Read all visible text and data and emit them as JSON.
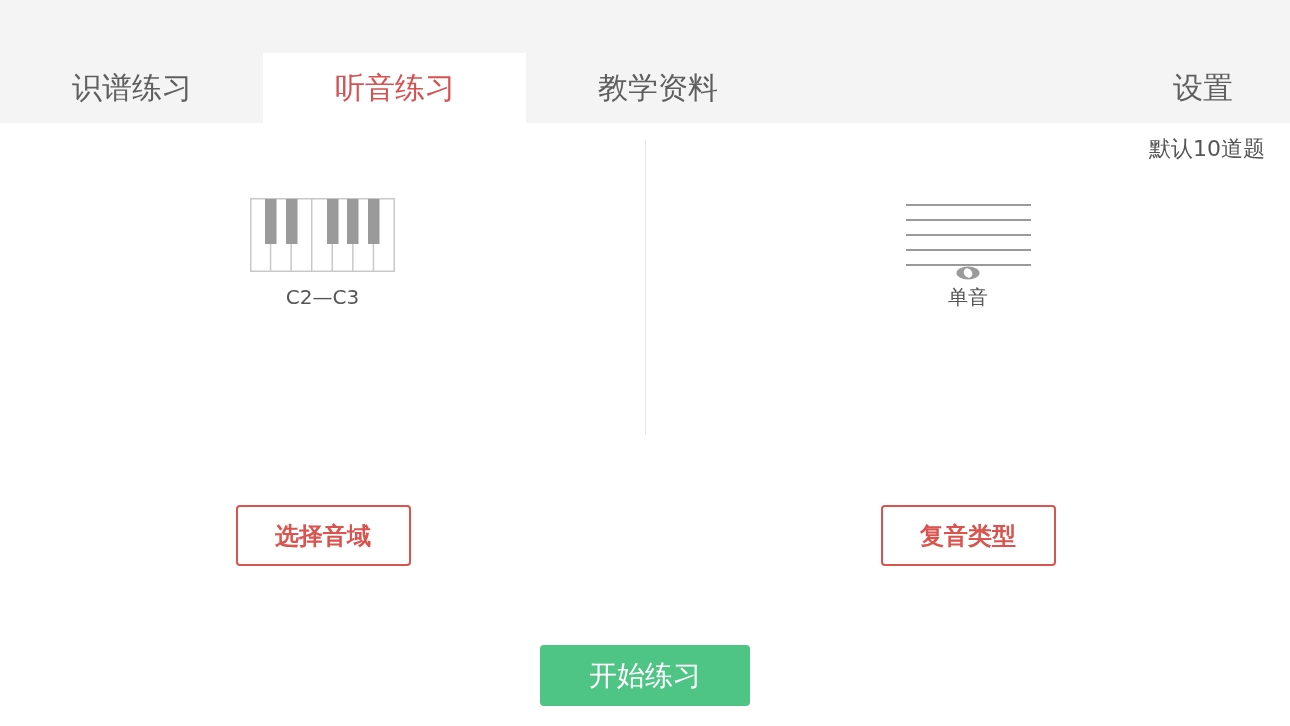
{
  "tabs": [
    {
      "label": "识谱练习",
      "selected": false
    },
    {
      "label": "听音练习",
      "selected": true
    },
    {
      "label": "教学资料",
      "selected": false
    }
  ],
  "settings": {
    "label": "设置"
  },
  "question_count": "默认10道题",
  "panels": [
    {
      "kind": "piano",
      "caption": "C2—C3",
      "button": "选择音域"
    },
    {
      "kind": "staff",
      "caption": "单音",
      "button": "复音类型"
    }
  ],
  "start_button": "开始练习"
}
